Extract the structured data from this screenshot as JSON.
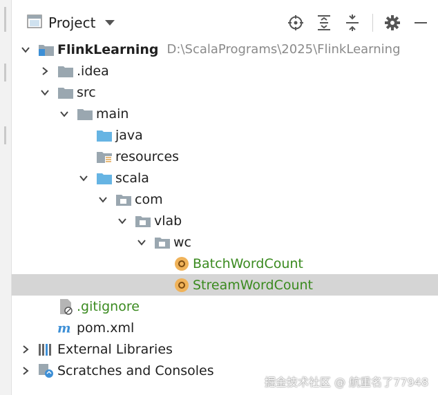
{
  "header": {
    "title": "Project",
    "tools": [
      "locate-icon",
      "expand-all-icon",
      "collapse-all-icon",
      "gear-icon",
      "minimize-icon"
    ]
  },
  "tree": [
    {
      "id": "root",
      "label": "FlinkLearning",
      "path": "D:\\ScalaPrograms\\2025\\FlinkLearning",
      "expanded": true
    },
    {
      "id": "idea",
      "label": ".idea",
      "expanded": false
    },
    {
      "id": "src",
      "label": "src",
      "expanded": true
    },
    {
      "id": "main",
      "label": "main",
      "expanded": true
    },
    {
      "id": "java",
      "label": "java"
    },
    {
      "id": "resources",
      "label": "resources"
    },
    {
      "id": "scala",
      "label": "scala",
      "expanded": true
    },
    {
      "id": "com",
      "label": "com",
      "expanded": true
    },
    {
      "id": "vlab",
      "label": "vlab",
      "expanded": true
    },
    {
      "id": "wc",
      "label": "wc",
      "expanded": true
    },
    {
      "id": "batch",
      "label": "BatchWordCount"
    },
    {
      "id": "stream",
      "label": "StreamWordCount",
      "selected": true
    },
    {
      "id": "gitignore",
      "label": ".gitignore"
    },
    {
      "id": "pom",
      "label": "pom.xml"
    },
    {
      "id": "extlib",
      "label": "External Libraries",
      "expanded": false
    },
    {
      "id": "scratches",
      "label": "Scratches and Consoles",
      "expanded": false
    }
  ],
  "watermark": "掘金技术社区 @ 航重名了77948",
  "colors": {
    "selection": "#d5d5d5",
    "green": "#3a8a1f",
    "folder": "#9aa7b0",
    "source_folder": "#66b4e3",
    "scala_badge": "#f0b35a"
  }
}
